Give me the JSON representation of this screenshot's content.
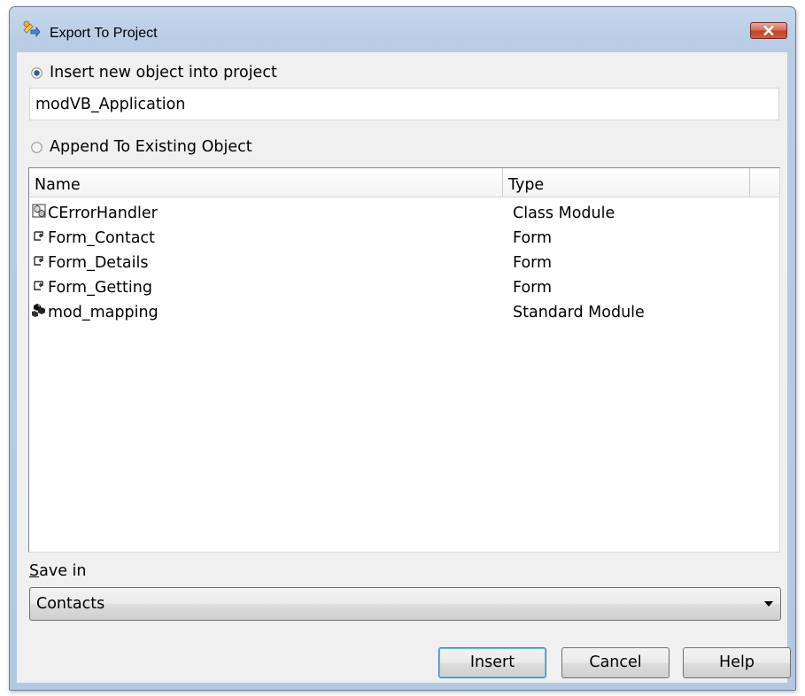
{
  "window": {
    "title": "Export To Project",
    "app_icon": "export-project-icon",
    "close_icon": "close-icon"
  },
  "insert_new": {
    "label": "Insert new object into project",
    "selected": true,
    "value": "modVB_Application"
  },
  "append_existing": {
    "label": "Append To Existing Object",
    "selected": false
  },
  "object_list": {
    "columns": [
      "Name",
      "Type"
    ],
    "rows": [
      {
        "name": "CErrorHandler",
        "type": "Class Module",
        "icon": "class-module-icon"
      },
      {
        "name": "Form_Contact",
        "type": "Form",
        "icon": "form-icon"
      },
      {
        "name": "Form_Details",
        "type": "Form",
        "icon": "form-icon"
      },
      {
        "name": "Form_Getting",
        "type": "Form",
        "icon": "form-icon"
      },
      {
        "name": "mod_mapping",
        "type": "Standard Module",
        "icon": "standard-module-icon"
      }
    ]
  },
  "save_in": {
    "label_first": "S",
    "label_rest": "ave in",
    "selected": "Contacts"
  },
  "buttons": {
    "insert": "Insert",
    "cancel": "Cancel",
    "help": "Help"
  },
  "colors": {
    "title_bar": "#b9cde6",
    "close_button": "#c9483a",
    "client": "#f0f0f0",
    "default_button_border": "#3c7fb1"
  }
}
